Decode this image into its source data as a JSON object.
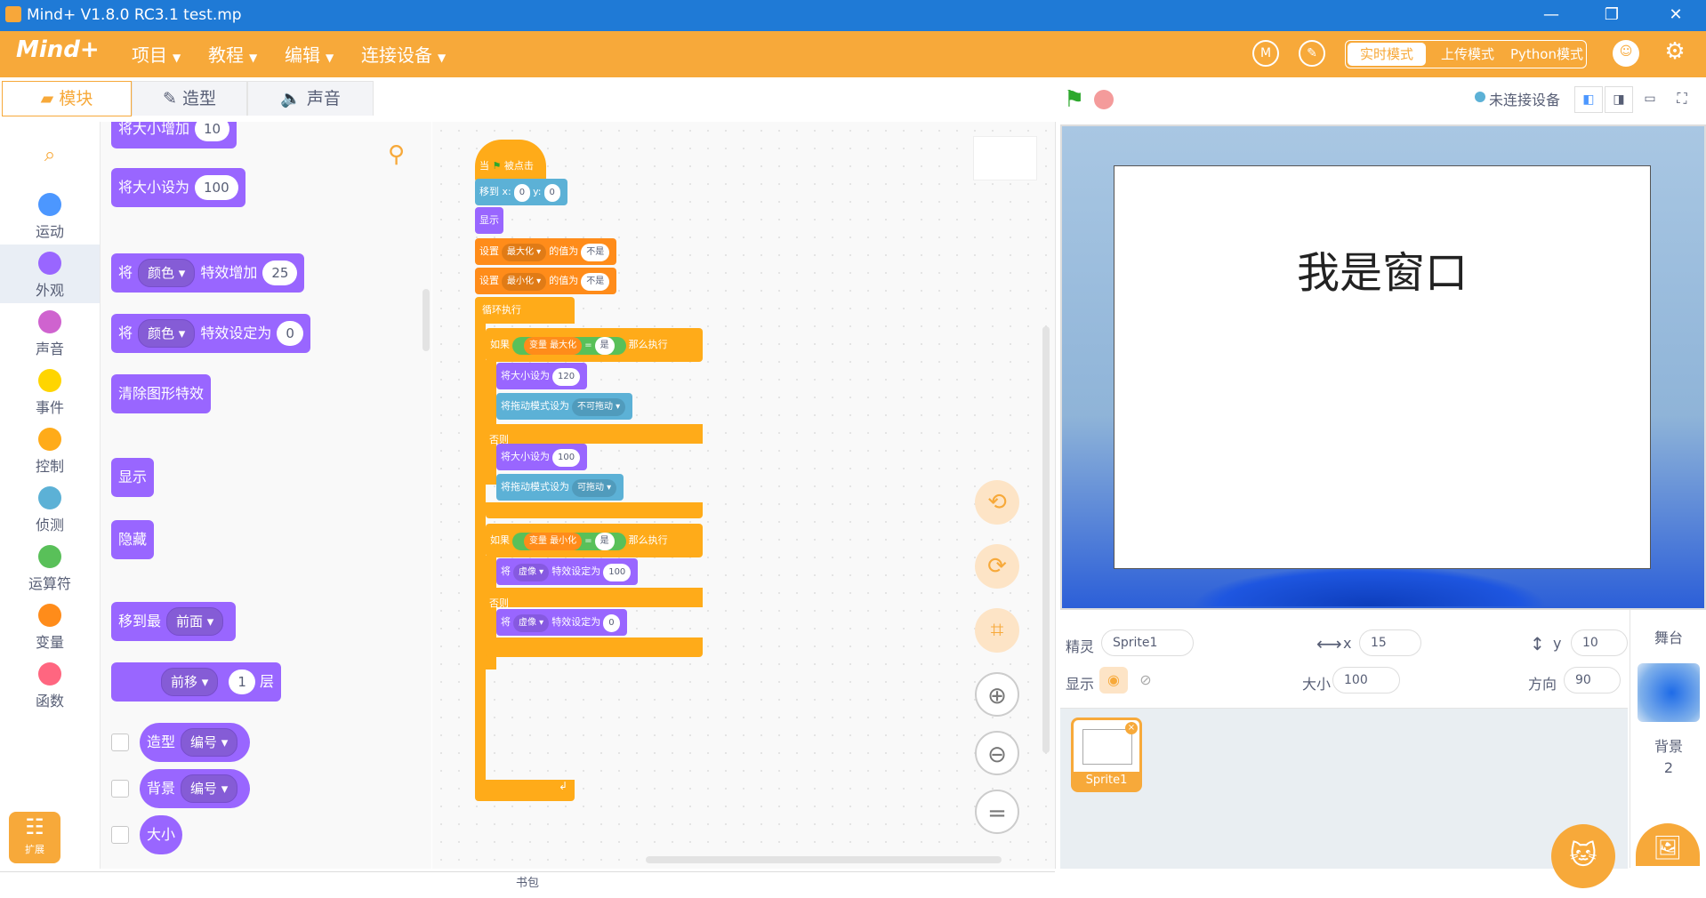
{
  "window": {
    "title": "Mind+ V1.8.0 RC3.1    test.mp"
  },
  "menubar": {
    "brand": "Mind+",
    "menus": [
      "项目",
      "教程",
      "编辑",
      "连接设备"
    ],
    "modes": {
      "realtime": "实时模式",
      "upload": "上传模式",
      "python": "Python模式"
    }
  },
  "tabs": {
    "blocks": "模块",
    "costumes": "造型",
    "sounds": "声音"
  },
  "categories": [
    {
      "label": "运动",
      "color": "#4c97ff"
    },
    {
      "label": "外观",
      "color": "#9966ff"
    },
    {
      "label": "声音",
      "color": "#cf63cf"
    },
    {
      "label": "事件",
      "color": "#ffd500"
    },
    {
      "label": "控制",
      "color": "#ffab19"
    },
    {
      "label": "侦测",
      "color": "#5cb1d6"
    },
    {
      "label": "运算符",
      "color": "#59c059"
    },
    {
      "label": "变量",
      "color": "#ff8c1a"
    },
    {
      "label": "函数",
      "color": "#ff6680"
    }
  ],
  "extension_label": "扩展",
  "palette": {
    "change_size": {
      "label": "将大小增加",
      "value": "10"
    },
    "set_size": {
      "label": "将大小设为",
      "value": "100"
    },
    "change_effect": {
      "prefix": "将",
      "effect": "颜色",
      "label": "特效增加",
      "value": "25"
    },
    "set_effect": {
      "prefix": "将",
      "effect": "颜色",
      "label": "特效设定为",
      "value": "0"
    },
    "clear_effects": "清除图形特效",
    "show": "显示",
    "hide": "隐藏",
    "goto_layer": {
      "label": "移到最",
      "option": "前面"
    },
    "move_layer": {
      "option": "前移",
      "value": "1",
      "suffix": "层"
    },
    "costume_reporter": {
      "label": "造型",
      "option": "编号"
    },
    "backdrop_reporter": {
      "label": "背景",
      "option": "编号"
    },
    "size_reporter": "大小"
  },
  "script": {
    "hat": {
      "prefix": "当",
      "suffix": "被点击"
    },
    "goto": {
      "label": "移到 x:",
      "x": "0",
      "ylabel": "y:",
      "y": "0"
    },
    "show": "显示",
    "set_max": {
      "label": "设置",
      "var": "最大化",
      "mid": "的值为",
      "value": "不是"
    },
    "set_min": {
      "label": "设置",
      "var": "最小化",
      "mid": "的值为",
      "value": "不是"
    },
    "forever": "循环执行",
    "if1": {
      "if": "如果",
      "var": "变量 最大化",
      "eq": "=",
      "value": "是",
      "then": "那么执行"
    },
    "size120": {
      "label": "将大小设为",
      "value": "120"
    },
    "drag_no": {
      "label": "将拖动模式设为",
      "value": "不可拖动"
    },
    "else1": "否则",
    "size100": {
      "label": "将大小设为",
      "value": "100"
    },
    "drag_yes": {
      "label": "将拖动模式设为",
      "value": "可拖动"
    },
    "if2": {
      "if": "如果",
      "var": "变量 最小化",
      "eq": "=",
      "value": "是",
      "then": "那么执行"
    },
    "ghost100": {
      "prefix": "将",
      "effect": "虚像",
      "label": "特效设定为",
      "value": "100"
    },
    "else2": "否则",
    "ghost0": {
      "prefix": "将",
      "effect": "虚像",
      "label": "特效设定为",
      "value": "0"
    }
  },
  "stage": {
    "connection_status": "未连接设备",
    "window_text": "我是窗口"
  },
  "sprite_info": {
    "sprite_label": "精灵",
    "sprite_name": "Sprite1",
    "x_label": "x",
    "x": "15",
    "y_label": "y",
    "y": "10",
    "show_label": "显示",
    "size_label": "大小",
    "size": "100",
    "direction_label": "方向",
    "direction": "90"
  },
  "sprites": [
    {
      "name": "Sprite1"
    }
  ],
  "stage_panel": {
    "title": "舞台",
    "backdrop_label": "背景",
    "backdrop_count": "2"
  },
  "backpack": "书包",
  "colors": {
    "accent": "#f7a93a",
    "titlebar": "#1f7ad6",
    "looks": "#9966ff",
    "control": "#ffab19",
    "sensing": "#5cb1d6"
  }
}
